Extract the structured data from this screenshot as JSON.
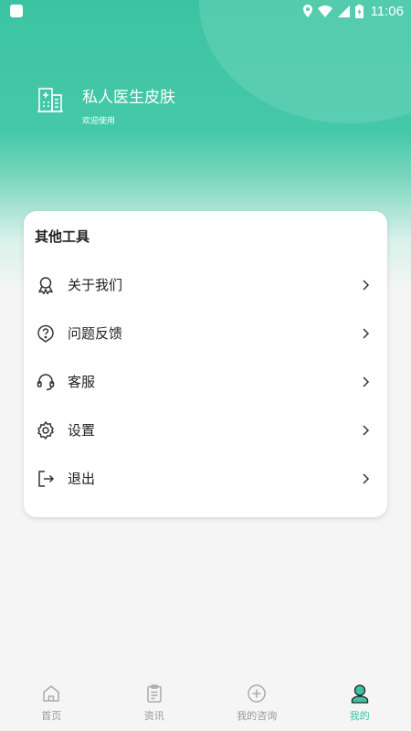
{
  "status_bar": {
    "time": "11:06"
  },
  "profile": {
    "name": "私人医生皮肤",
    "subtitle": "欢迎使用"
  },
  "tools": {
    "title": "其他工具",
    "items": [
      {
        "label": "关于我们",
        "icon": "ribbon-icon"
      },
      {
        "label": "问题反馈",
        "icon": "question-icon"
      },
      {
        "label": "客服",
        "icon": "headset-icon"
      },
      {
        "label": "设置",
        "icon": "gear-icon"
      },
      {
        "label": "退出",
        "icon": "logout-icon"
      }
    ]
  },
  "tabbar": {
    "items": [
      {
        "label": "首页",
        "icon": "home-icon",
        "active": false
      },
      {
        "label": "资讯",
        "icon": "clipboard-icon",
        "active": false
      },
      {
        "label": "我的咨询",
        "icon": "plus-circle-icon",
        "active": false
      },
      {
        "label": "我的",
        "icon": "user-icon",
        "active": true
      }
    ]
  },
  "colors": {
    "accent": "#3cc4a2",
    "inactive": "#999999"
  }
}
